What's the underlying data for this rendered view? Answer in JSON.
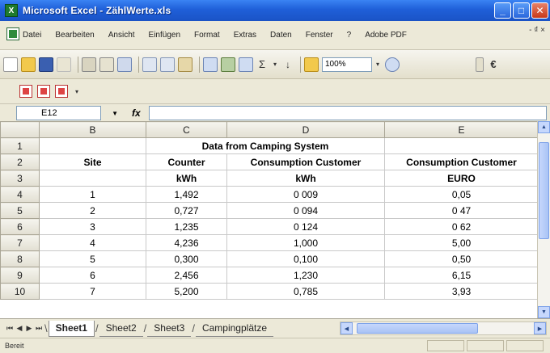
{
  "window": {
    "title": "Microsoft Excel - ZählWerte.xls",
    "app_icon": "excel-icon",
    "buttons": [
      "minimize",
      "maximize",
      "close"
    ]
  },
  "menu": {
    "items": [
      "Datei",
      "Bearbeiten",
      "Ansicht",
      "Einfügen",
      "Format",
      "Extras",
      "Daten",
      "Fenster",
      "?",
      "Adobe PDF"
    ],
    "overflow": "- ₫ ×"
  },
  "toolbar": {
    "zoom": "100%",
    "sum_symbol": "Σ",
    "sort_symbol": "↓",
    "euro_symbol": "€"
  },
  "formula_bar": {
    "cell_ref": "E12",
    "fx_label": "fx",
    "formula": ""
  },
  "sheet": {
    "columns": [
      "B",
      "C",
      "D",
      "E"
    ],
    "title": "Data from Camping System",
    "header_row_2": [
      "Site",
      "Counter",
      "Consumption Customer",
      "Consumption Customer"
    ],
    "header_row_3": [
      "",
      "kWh",
      "kWh",
      "EURO"
    ],
    "row_numbers": [
      "1",
      "2",
      "3",
      "4",
      "5",
      "6",
      "7",
      "8",
      "9",
      "10"
    ],
    "rows": [
      {
        "site": "1",
        "counter": "1,492",
        "cons_kwh": "0 009",
        "cons_euro": "0,05"
      },
      {
        "site": "2",
        "counter": "0,727",
        "cons_kwh": "0 094",
        "cons_euro": "0 47"
      },
      {
        "site": "3",
        "counter": "1,235",
        "cons_kwh": "0 124",
        "cons_euro": "0 62"
      },
      {
        "site": "4",
        "counter": "4,236",
        "cons_kwh": "1,000",
        "cons_euro": "5,00"
      },
      {
        "site": "5",
        "counter": "0,300",
        "cons_kwh": "0,100",
        "cons_euro": "0,50"
      },
      {
        "site": "6",
        "counter": "2,456",
        "cons_kwh": "1,230",
        "cons_euro": "6,15"
      },
      {
        "site": "7",
        "counter": "5,200",
        "cons_kwh": "0,785",
        "cons_euro": "3,93"
      }
    ]
  },
  "tabs": {
    "nav": [
      "⏮",
      "◀",
      "▶",
      "⏭"
    ],
    "sheets": [
      "Sheet1",
      "Sheet2",
      "Sheet3",
      "Campingplätze"
    ],
    "active": "Sheet1"
  },
  "status": {
    "text": "Bereit"
  },
  "colors": {
    "titlebar": "#1f5fd8",
    "grid_lines": "#c9c9c9",
    "header_bg": "#e2dfd2"
  }
}
